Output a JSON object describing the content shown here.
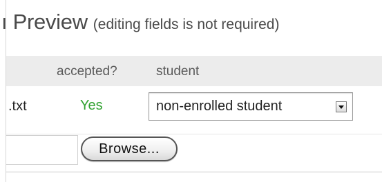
{
  "title": {
    "main": "ı Preview",
    "note": "(editing fields is not required)"
  },
  "table": {
    "columns": [
      "accepted?",
      "student"
    ],
    "rows": [
      {
        "file": ".txt",
        "accepted": "Yes",
        "student_select": "non-enrolled student"
      }
    ]
  },
  "upload": {
    "browse_label": "Browse..."
  },
  "colors": {
    "accepted_green": "#31a231",
    "header_bg": "#ececec",
    "text_gray": "#4a4a4a"
  }
}
